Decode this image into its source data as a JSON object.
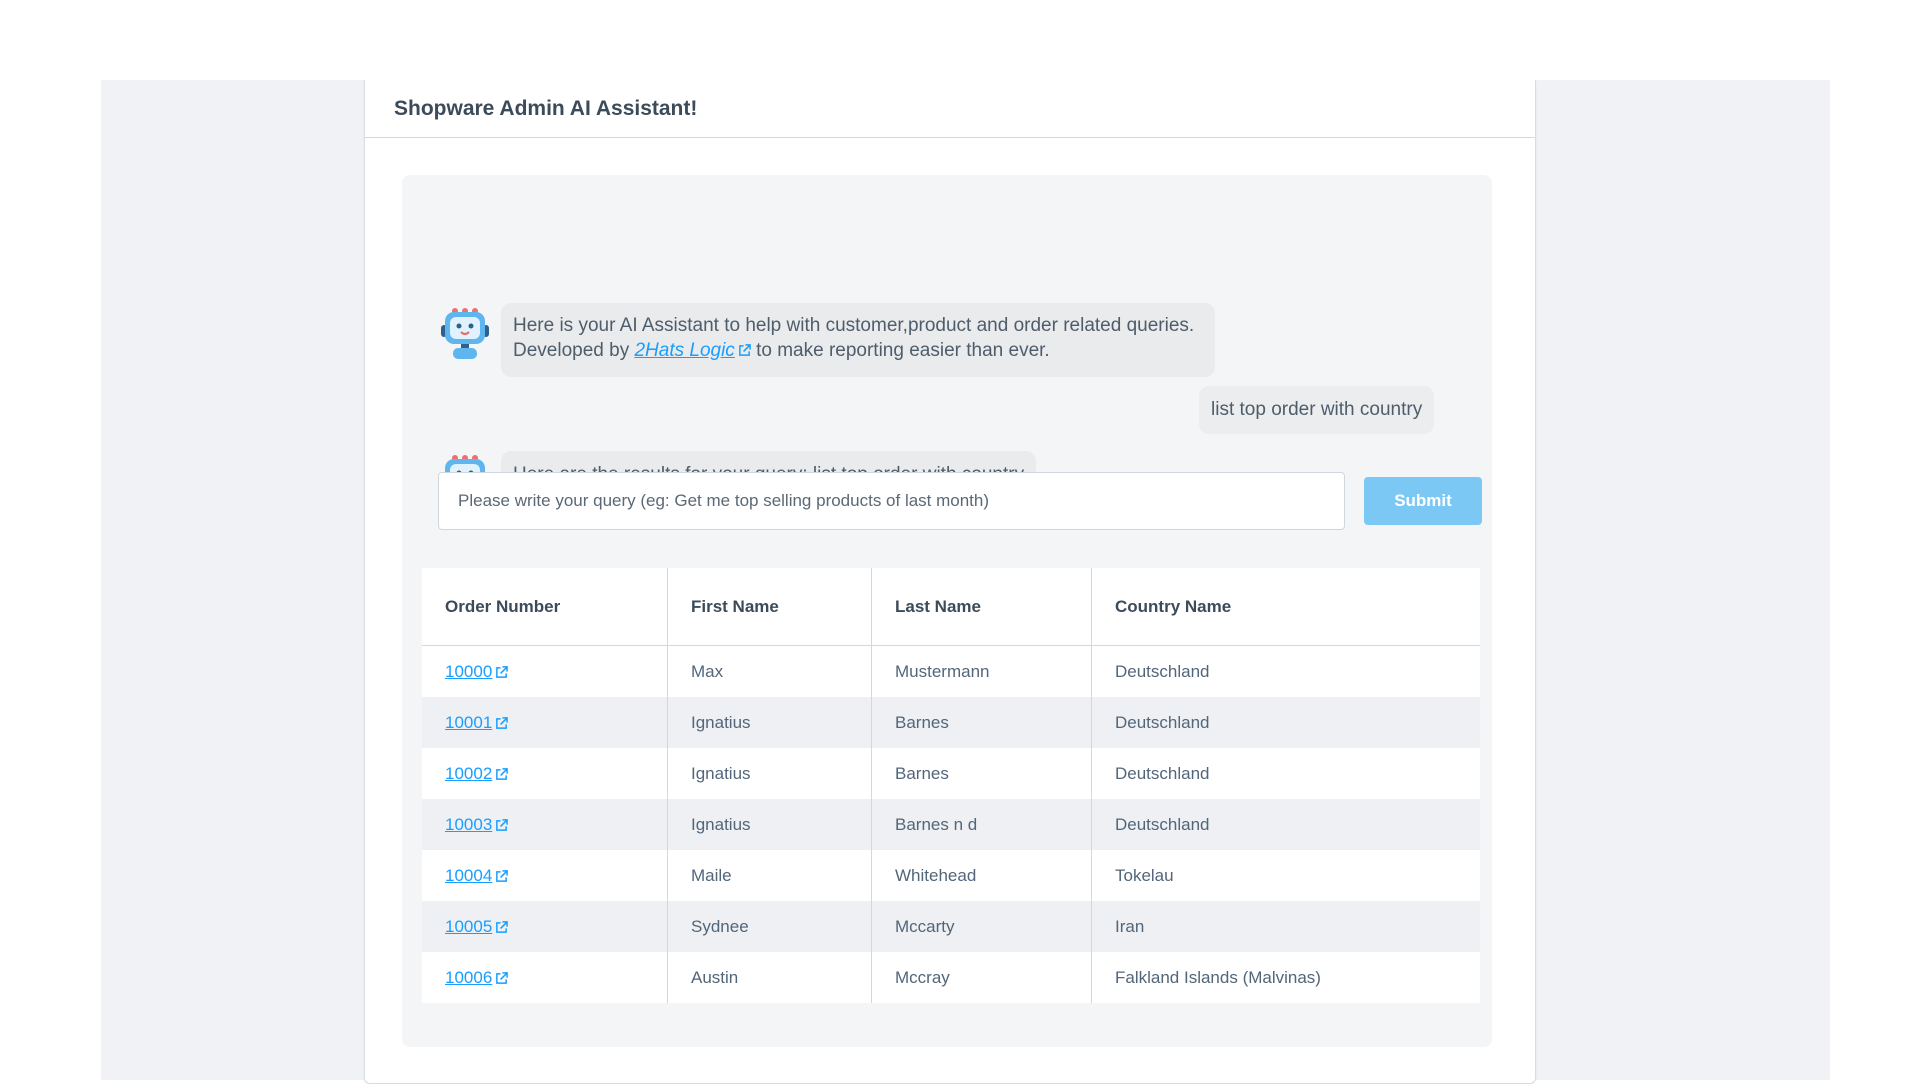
{
  "header": {
    "title": "Shopware Admin AI Assistant!"
  },
  "messages": [
    {
      "role": "assistant",
      "text_before": "Here is your AI Assistant to help with customer,product and order related queries. Developed by ",
      "link_text": "2Hats Logic",
      "text_after": " to make reporting easier than ever."
    },
    {
      "role": "user",
      "text": "list top order with country"
    },
    {
      "role": "assistant",
      "text": "Here are the results for your query: list top order with country"
    }
  ],
  "query_form": {
    "placeholder": "Please write your query (eg: Get me top selling products of last month)",
    "value": "",
    "submit_label": "Submit",
    "submit_color": "#7cc8f5"
  },
  "results_table": {
    "columns": [
      "Order Number",
      "First Name",
      "Last Name",
      "Country Name"
    ],
    "rows": [
      {
        "order_number": "10000",
        "first_name": "Max",
        "last_name": "Mustermann",
        "country": "Deutschland"
      },
      {
        "order_number": "10001",
        "first_name": "Ignatius",
        "last_name": "Barnes",
        "country": "Deutschland"
      },
      {
        "order_number": "10002",
        "first_name": "Ignatius",
        "last_name": "Barnes",
        "country": "Deutschland"
      },
      {
        "order_number": "10003",
        "first_name": "Ignatius",
        "last_name": "Barnes n d",
        "country": "Deutschland"
      },
      {
        "order_number": "10004",
        "first_name": "Maile",
        "last_name": "Whitehead",
        "country": "Tokelau"
      },
      {
        "order_number": "10005",
        "first_name": "Sydnee",
        "last_name": "Mccarty",
        "country": "Iran"
      },
      {
        "order_number": "10006",
        "first_name": "Austin",
        "last_name": "Mccray",
        "country": "Falkland Islands (Malvinas)"
      }
    ]
  },
  "colors": {
    "link": "#189eff",
    "page_background": "#f0f2f5",
    "chat_background": "#f4f5f7",
    "bubble": "#e9ebed"
  },
  "icons": {
    "avatar": "robot-avatar-icon",
    "external_link": "external-link-icon"
  }
}
